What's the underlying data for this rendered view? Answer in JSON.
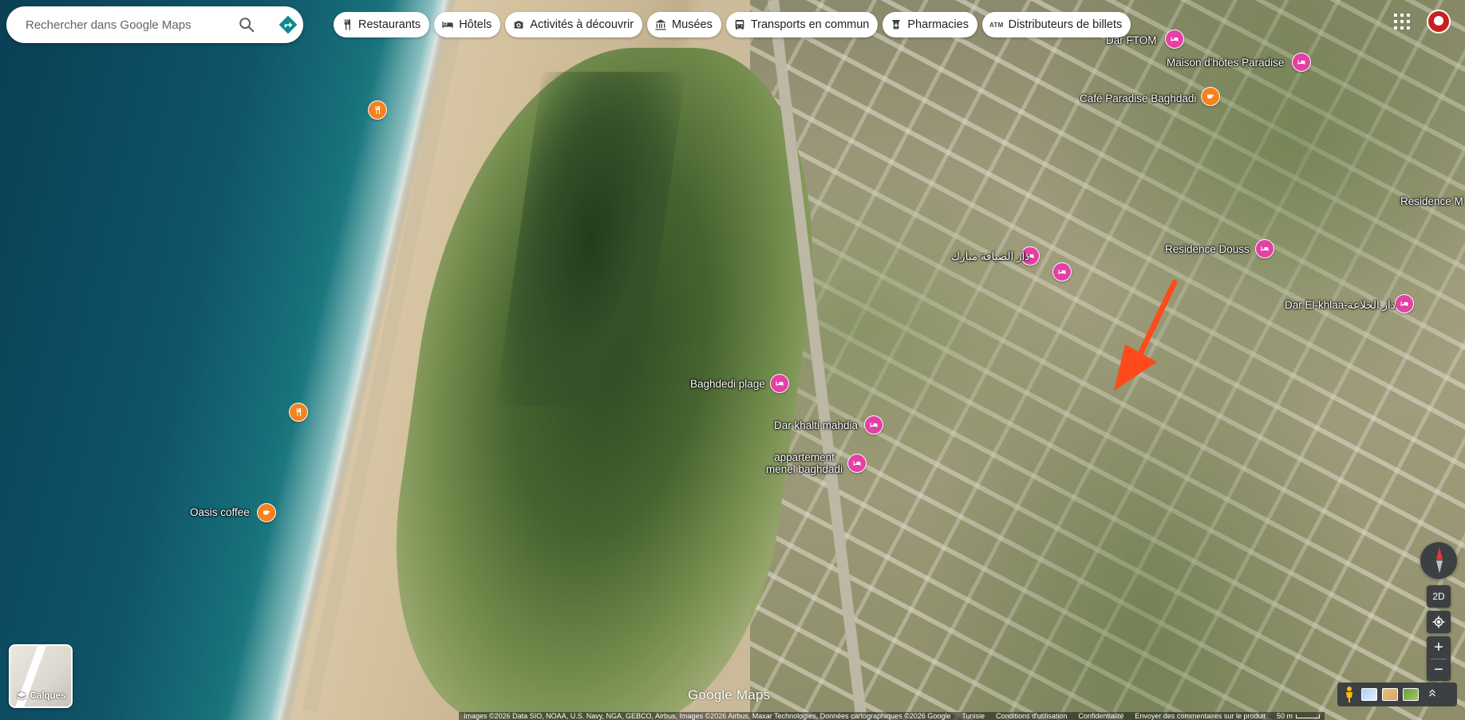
{
  "search": {
    "placeholder": "Rechercher dans Google Maps"
  },
  "chips": [
    {
      "label": "Restaurants",
      "icon": "fork-knife-icon"
    },
    {
      "label": "Hôtels",
      "icon": "bed-icon"
    },
    {
      "label": "Activités à découvrir",
      "icon": "camera-icon"
    },
    {
      "label": "Musées",
      "icon": "museum-icon"
    },
    {
      "label": "Transports en commun",
      "icon": "bus-icon"
    },
    {
      "label": "Pharmacies",
      "icon": "pharmacy-icon"
    },
    {
      "label": "Distributeurs de billets",
      "icon": "atm-icon",
      "icon_text": "ATM"
    }
  ],
  "places": [
    {
      "name": "Dar FTOM",
      "type": "hotel"
    },
    {
      "name": "Maison d'hôtes Paradise",
      "type": "hotel"
    },
    {
      "name": "Café Paradise Baghdadi",
      "type": "food"
    },
    {
      "name": "Residence M",
      "type": "hotel"
    },
    {
      "name": "دار الضيافة مبارك",
      "type": "hotel"
    },
    {
      "name": "",
      "type": "hotel"
    },
    {
      "name": "Residence Douss",
      "type": "hotel"
    },
    {
      "name": "Dar El-khlaa-دار الخلاعة",
      "type": "hotel"
    },
    {
      "name": "Baghdedi plage",
      "type": "hotel"
    },
    {
      "name": "Dar khalti mahdia",
      "type": "hotel"
    },
    {
      "name": "appartement menel baghdadi",
      "type": "hotel"
    },
    {
      "name": "Oasis coffee",
      "type": "food"
    },
    {
      "name": "",
      "type": "food"
    },
    {
      "name": "",
      "type": "food"
    }
  ],
  "layers": {
    "label": "Calques"
  },
  "controls": {
    "mode_2d": "2D",
    "zoom_in": "+",
    "zoom_out": "−"
  },
  "logo": "Google Maps",
  "attribution": {
    "imagery": "Images ©2026 Data SIO, NOAA, U.S. Navy, NGA, GEBCO, Airbus, Images ©2026 Airbus, Maxar Technologies, Données cartographiques ©2026 Google",
    "country": "Tunisie",
    "terms": "Conditions d'utilisation",
    "privacy": "Confidentialité",
    "feedback": "Envoyer des commentaires sur le produit",
    "scale": "50 m"
  },
  "colors": {
    "hotel_pin": "#e540a3",
    "food_pin": "#f5821f",
    "arrow": "#ff4a1c"
  }
}
